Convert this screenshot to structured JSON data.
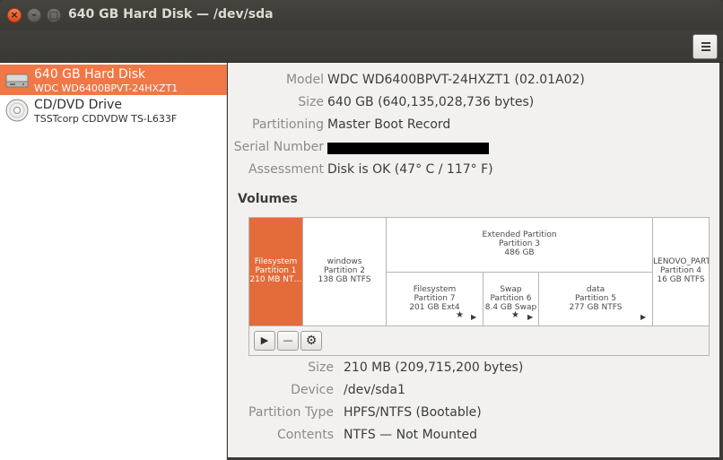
{
  "window": {
    "title": "640 GB Hard Disk — /dev/sda",
    "close_glyph": "×",
    "minimize_glyph": "–",
    "maximize_glyph": "□"
  },
  "toolbar": {
    "menu_icon": "hamburger-menu-icon"
  },
  "drives": [
    {
      "name": "640 GB Hard Disk",
      "sub": "WDC WD6400BPVT-24HXZT1",
      "icon": "hard-disk-icon",
      "selected": true
    },
    {
      "name": "CD/DVD Drive",
      "sub": "TSSTcorp CDDVDW TS-L633F",
      "icon": "optical-disc-icon",
      "selected": false
    }
  ],
  "disk": {
    "model_label": "Model",
    "model": "WDC WD6400BPVT-24HXZT1 (02.01A02)",
    "size_label": "Size",
    "size": "640 GB (640,135,028,736 bytes)",
    "partitioning_label": "Partitioning",
    "partitioning": "Master Boot Record",
    "serial_label": "Serial Number",
    "serial": "",
    "assessment_label": "Assessment",
    "assessment": "Disk is OK (47° C / 117° F)"
  },
  "volumes": {
    "title": "Volumes",
    "segments": [
      {
        "l1": "Filesystem",
        "l2": "Partition 1",
        "l3": "210 MB NT…",
        "selected": true
      },
      {
        "l1": "windows",
        "l2": "Partition 2",
        "l3": "138 GB NTFS"
      },
      {
        "l1": "Extended Partition",
        "l2": "Partition 3",
        "l3": "486 GB"
      },
      {
        "l1": "Filesystem",
        "l2": "Partition 7",
        "l3": "201 GB Ext4",
        "star": true,
        "play": true
      },
      {
        "l1": "Swap",
        "l2": "Partition 6",
        "l3": "8.4 GB Swap",
        "star": true,
        "play": true
      },
      {
        "l1": "data",
        "l2": "Partition 5",
        "l3": "277 GB NTFS",
        "play": true
      },
      {
        "l1": "LENOVO_PART",
        "l2": "Partition 4",
        "l3": "16 GB NTFS"
      }
    ],
    "buttons": [
      {
        "icon": "play-icon",
        "glyph": "▶"
      },
      {
        "icon": "minus-icon",
        "glyph": "—"
      },
      {
        "icon": "gear-icon",
        "glyph": "⚙"
      }
    ],
    "star_glyph": "★",
    "play_glyph": "▶"
  },
  "volume": {
    "size_label": "Size",
    "size": "210 MB (209,715,200 bytes)",
    "device_label": "Device",
    "device": "/dev/sda1",
    "ptype_label": "Partition Type",
    "ptype": "HPFS/NTFS (Bootable)",
    "contents_label": "Contents",
    "contents": "NTFS — Not Mounted"
  }
}
